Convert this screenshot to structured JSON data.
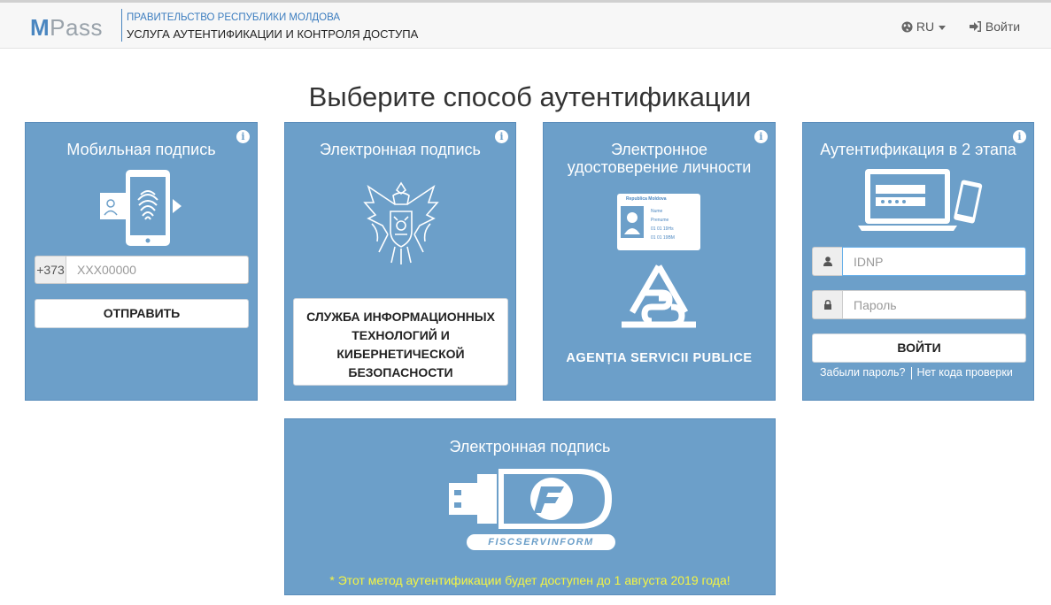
{
  "header": {
    "logo_m": "M",
    "logo_rest": "Pass",
    "gov": "ПРАВИТЕЛЬСТВО РЕСПУБЛИКИ МОЛДОВА",
    "service": "УСЛУГА АУТЕНТИФИКАЦИИ И КОНТРОЛЯ ДОСТУПА",
    "language": "RU",
    "login": "Войти"
  },
  "page": {
    "title": "Выберите способ аутентификации"
  },
  "cards": {
    "mobile": {
      "title": "Мобильная подпись",
      "prefix": "+373",
      "phone_placeholder": "XXX00000",
      "phone_value": "",
      "send": "ОТПРАВИТЬ"
    },
    "esign": {
      "title": "Электронная подпись",
      "provider": "СЛУЖБА ИНФОРМАЦИОННЫХ ТЕХНОЛОГИЙ И КИБЕРНЕТИЧЕСКОЙ БЕЗОПАСНОСТИ"
    },
    "eid": {
      "title_line1": "Электронное",
      "title_line2": "удостоверение личности",
      "id_header": "Republica Moldova",
      "id_line1": "Nume",
      "id_line2": "Prenume",
      "id_line3": "01 01 19Hs",
      "id_line4": "01 01 19BM",
      "agency": "AGENȚIA SERVICII PUBLICE"
    },
    "twostep": {
      "title": "Аутентификация в 2 этапа",
      "idnp_placeholder": "IDNP",
      "idnp_value": "",
      "password_placeholder": "Пароль",
      "password_value": "",
      "login": "ВОЙТИ",
      "forgot": "Забыли пароль?",
      "no_code": "Нет кода проверки"
    },
    "usb": {
      "title": "Электронная подпись",
      "brand": "FISCSERVINFORM",
      "notice": "* Этот метод аутентификации будет доступен до 1 августа 2019 года!"
    }
  },
  "icons": {
    "info": "info-icon",
    "globe": "globe-icon",
    "login": "sign-in-icon",
    "user": "user-icon",
    "lock": "lock-icon"
  },
  "colors": {
    "card_bg": "#6c9fc9",
    "brand_blue": "#4a86c0",
    "notice_yellow": "#f5f542"
  }
}
